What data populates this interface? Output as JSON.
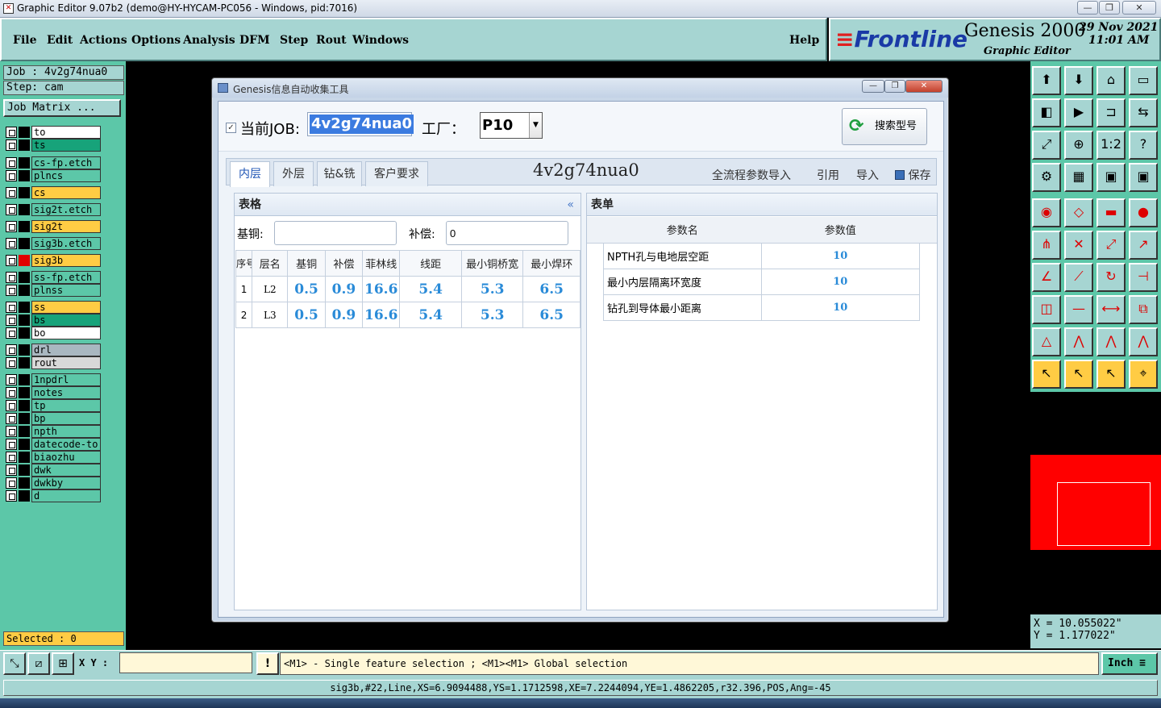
{
  "window": {
    "title": "Graphic Editor 9.07b2 (demo@HY-HYCAM-PC056 - Windows, pid:7016)",
    "min_glyph": "—",
    "max_glyph": "❐",
    "close_glyph": "✕"
  },
  "menu": [
    "File",
    "Edit",
    "Actions",
    "Options",
    "Analysis",
    "DFM",
    "Step",
    "Rout",
    "Windows"
  ],
  "help_label": "Help",
  "brand": {
    "logo_text": "Frontline",
    "product": "Genesis 2000",
    "subtitle": "Graphic Editor",
    "date": "29 Nov 2021",
    "time": "11:01 AM"
  },
  "left": {
    "job_line": "Job : 4v2g74nua0",
    "step_line": "Step: cam",
    "job_matrix": "Job Matrix ...",
    "layers": [
      {
        "name": "to",
        "color": "#ffffff"
      },
      {
        "name": "ts",
        "color": "#17a37a"
      },
      {
        "name": "cs-fp.etch",
        "color": "#5cc7a8"
      },
      {
        "name": "plncs",
        "color": "#5cc7a8"
      },
      {
        "name": "cs",
        "color": "#ffcc44"
      },
      {
        "name": "sig2t.etch",
        "color": "#5cc7a8"
      },
      {
        "name": "sig2t",
        "color": "#ffcc44"
      },
      {
        "name": "sig3b.etch",
        "color": "#5cc7a8"
      },
      {
        "name": "sig3b",
        "color": "#ffcc44"
      },
      {
        "name": "ss-fp.etch",
        "color": "#5cc7a8"
      },
      {
        "name": "plnss",
        "color": "#5cc7a8"
      },
      {
        "name": "ss",
        "color": "#ffcc44"
      },
      {
        "name": "bs",
        "color": "#17a37a"
      },
      {
        "name": "bo",
        "color": "#ffffff"
      },
      {
        "name": "drl",
        "color": "#a9b7c0"
      },
      {
        "name": "rout",
        "color": "#d8d8d8"
      },
      {
        "name": "1npdrl",
        "color": "#5cc7a8"
      },
      {
        "name": "notes",
        "color": "#5cc7a8"
      },
      {
        "name": "tp",
        "color": "#5cc7a8"
      },
      {
        "name": "bp",
        "color": "#5cc7a8"
      },
      {
        "name": "npth",
        "color": "#5cc7a8"
      },
      {
        "name": "datecode-to",
        "color": "#5cc7a8"
      },
      {
        "name": "biaozhu",
        "color": "#5cc7a8"
      },
      {
        "name": "dwk",
        "color": "#5cc7a8"
      },
      {
        "name": "dwkby",
        "color": "#5cc7a8"
      },
      {
        "name": "d",
        "color": "#5cc7a8"
      }
    ],
    "selected": "Selected : 0"
  },
  "coords": {
    "x": "X = 10.055022\"",
    "y": "Y = 1.177022\""
  },
  "bottom": {
    "xy_label": "X Y :",
    "xy_value": "",
    "hint": "<M1> - Single feature selection ; <M1><M1> Global selection",
    "unit": "Inch",
    "status": "sig3b,#22,Line,XS=6.9094488,YS=1.1712598,XE=7.2244094,YE=1.4862205,r32.396,POS,Ang=-45"
  },
  "dialog": {
    "title": "Genesis信息自动收集工具",
    "job_label": "当前JOB:",
    "job_value": "4v2g74nua0",
    "factory_label": "工厂：",
    "factory_value": "P10",
    "search_label": "搜索型号",
    "tabs": [
      "内层",
      "外层",
      "钻&铣",
      "客户要求"
    ],
    "job_heading": "4v2g74nua0",
    "actions": {
      "import_all": "全流程参数导入",
      "cite": "引用",
      "import": "导入",
      "save": "保存"
    },
    "left_panel": {
      "title": "表格",
      "base_label": "基铜:",
      "base_value": "",
      "comp_label": "补偿:",
      "comp_value": "0",
      "columns": [
        "序号",
        "层名",
        "基铜",
        "补偿",
        "菲林线",
        "线距",
        "最小铜桥宽",
        "最小焊环"
      ],
      "rows": [
        [
          "1",
          "L2",
          "0.5",
          "0.9",
          "16.6",
          "5.4",
          "5.3",
          "6.5"
        ],
        [
          "2",
          "L3",
          "0.5",
          "0.9",
          "16.6",
          "5.4",
          "5.3",
          "6.5"
        ]
      ]
    },
    "right_panel": {
      "title": "表单",
      "columns": [
        "参数名",
        "参数值"
      ],
      "rows": [
        [
          "NPTH孔与电地层空距",
          "10"
        ],
        [
          "最小内层隔离环宽度",
          "10"
        ],
        [
          "钻孔到导体最小距离",
          "10"
        ]
      ]
    }
  }
}
